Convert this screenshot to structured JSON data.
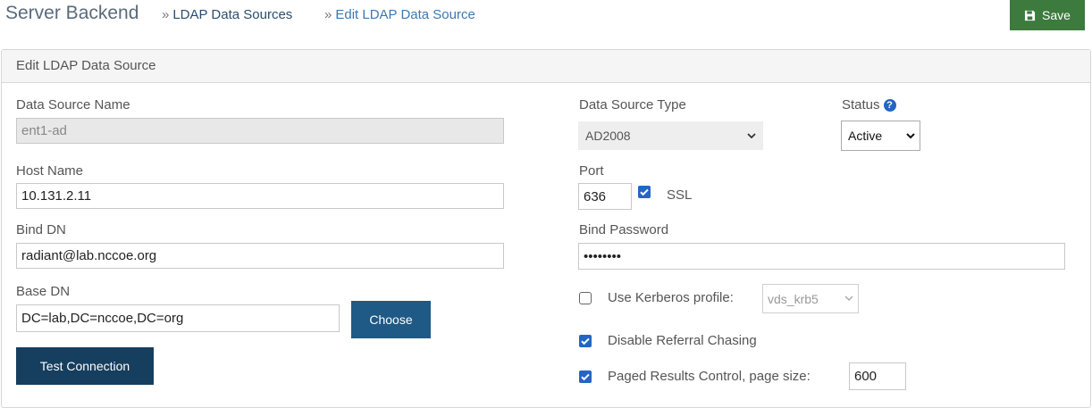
{
  "breadcrumb": {
    "root": "Server Backend",
    "separator": "»",
    "items": [
      "LDAP Data Sources",
      "Edit LDAP Data Source"
    ]
  },
  "toolbar": {
    "save_label": "Save",
    "save_icon": "floppy-disk-icon"
  },
  "panel": {
    "title": "Edit LDAP Data Source"
  },
  "form": {
    "data_source_name": {
      "label": "Data Source Name",
      "value": "ent1-ad"
    },
    "data_source_type": {
      "label": "Data Source Type",
      "value": "AD2008"
    },
    "status": {
      "label": "Status",
      "value": "Active",
      "help_icon": "question-circle-icon"
    },
    "host_name": {
      "label": "Host Name",
      "value": "10.131.2.11"
    },
    "port": {
      "label": "Port",
      "value": "636"
    },
    "ssl": {
      "label": "SSL",
      "checked": true
    },
    "bind_dn": {
      "label": "Bind DN",
      "value": "radiant@lab.nccoe.org"
    },
    "bind_password": {
      "label": "Bind Password",
      "value": "••••••••"
    },
    "base_dn": {
      "label": "Base DN",
      "value": "DC=lab,DC=nccoe,DC=org"
    },
    "choose_label": "Choose",
    "test_connection_label": "Test Connection",
    "use_kerberos": {
      "label": "Use Kerberos profile:",
      "checked": false,
      "profile": "vds_krb5"
    },
    "disable_referral": {
      "label": "Disable Referral Chasing",
      "checked": true
    },
    "paged_results": {
      "label": "Paged Results Control, page size:",
      "checked": true,
      "page_size": "600"
    }
  },
  "colors": {
    "save_green": "#3c7a3e",
    "button_blue": "#1f5985",
    "checkbox_blue": "#2366c4"
  }
}
